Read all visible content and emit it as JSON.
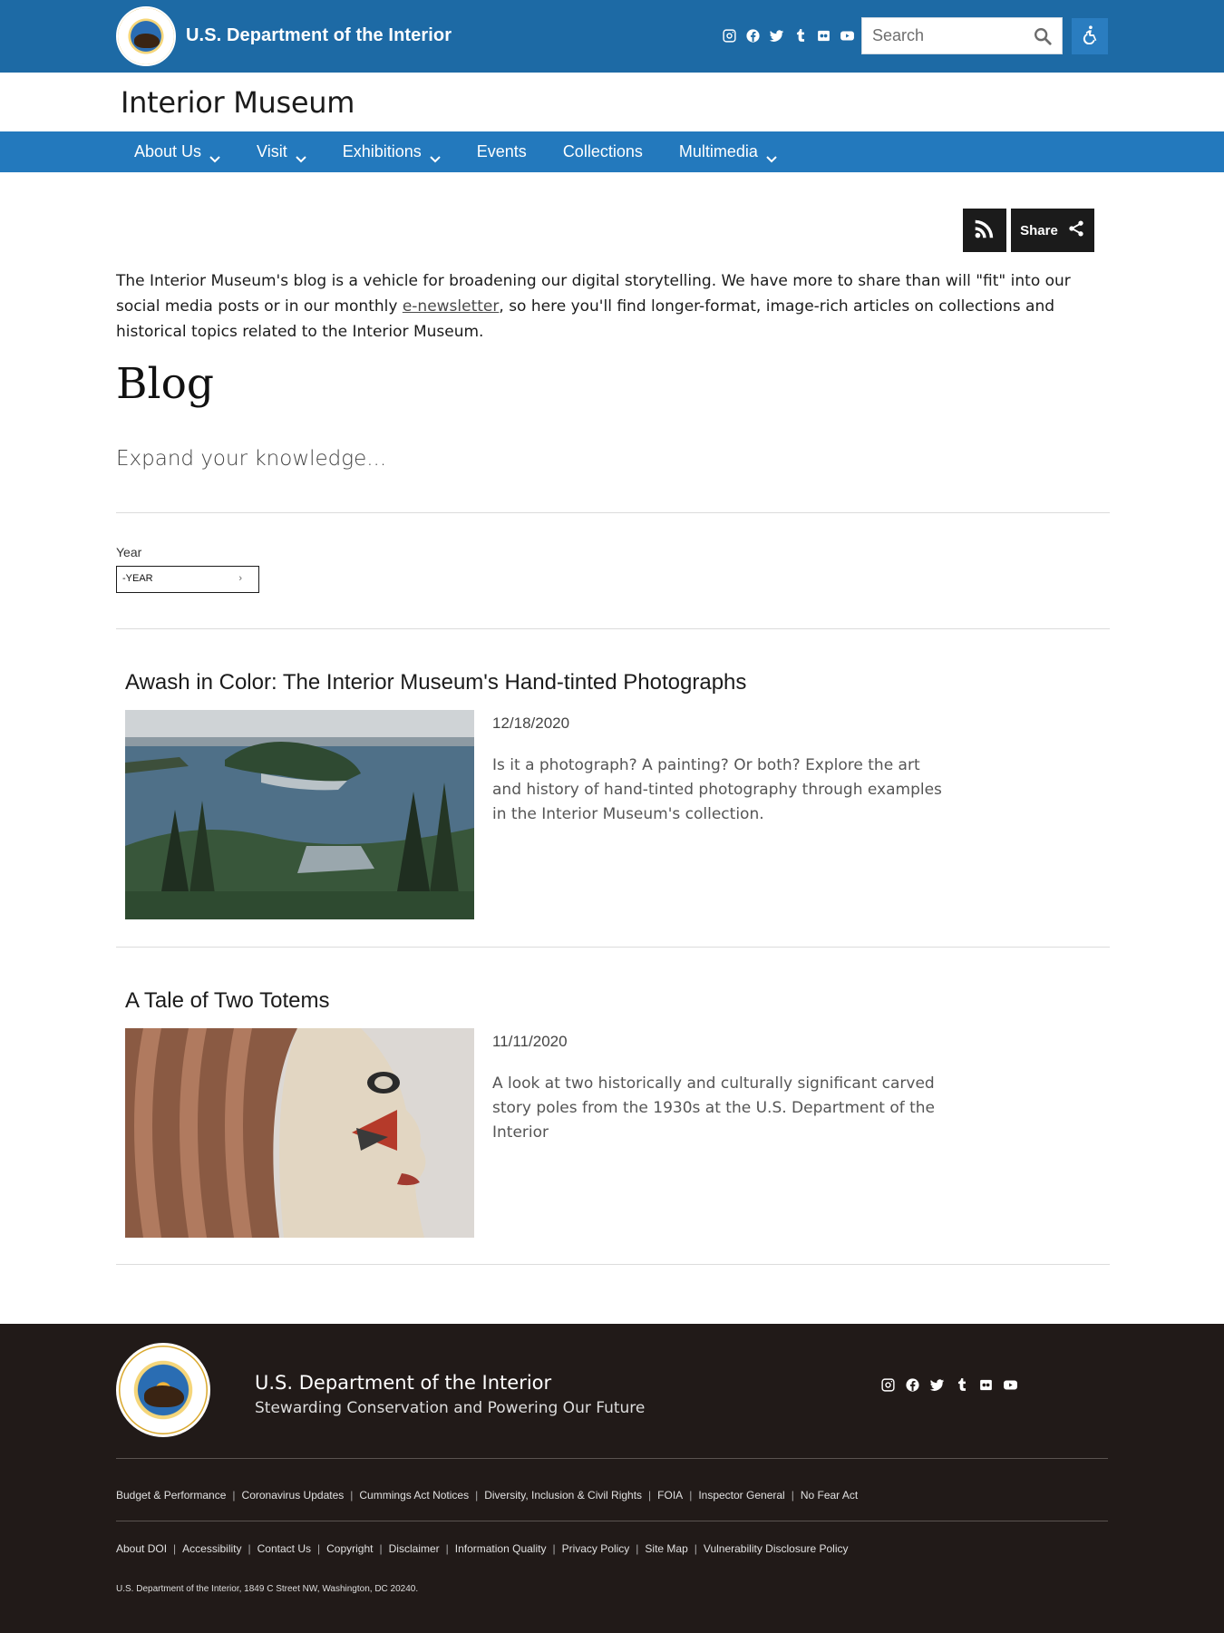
{
  "header": {
    "dept_title": "U.S. Department of the Interior",
    "search_placeholder": "Search",
    "social_icons": [
      "instagram-icon",
      "facebook-icon",
      "twitter-icon",
      "tumblr-icon",
      "flickr-icon",
      "youtube-icon"
    ],
    "accessibility_icon": "accessibility-icon"
  },
  "site": {
    "title": "Interior Museum"
  },
  "nav": {
    "items": [
      {
        "label": "About Us",
        "dropdown": true
      },
      {
        "label": "Visit",
        "dropdown": true
      },
      {
        "label": "Exhibitions",
        "dropdown": true
      },
      {
        "label": "Events",
        "dropdown": false
      },
      {
        "label": "Collections",
        "dropdown": false
      },
      {
        "label": "Multimedia",
        "dropdown": true
      }
    ]
  },
  "share": {
    "label": "Share",
    "rss_icon": "rss-icon"
  },
  "intro": {
    "text_before": "The Interior Museum's blog is a vehicle for broadening our digital storytelling. We have more to share than will \"fit\" into our social media posts or in our monthly ",
    "link_text": "e-newsletter",
    "text_after": ", so here you'll find longer-format, image-rich articles on collections and historical topics related to the Interior Museum."
  },
  "blog": {
    "heading": "Blog",
    "tagline": "Expand your knowledge..."
  },
  "filter": {
    "year_label": "Year",
    "year_value": "-YEAR"
  },
  "articles": [
    {
      "title": "Awash in Color: The Interior Museum's Hand-tinted Photographs",
      "date": "12/18/2020",
      "description": "Is it a photograph? A painting? Or both? Explore the art and history of hand-tinted photography through examples in the Interior Museum's collection."
    },
    {
      "title": "A Tale of Two Totems",
      "date": "11/11/2020",
      "description": "A look at two historically and culturally significant carved story poles from the 1930s at the U.S. Department of the Interior"
    }
  ],
  "footer": {
    "dept": "U.S. Department of the Interior",
    "tagline": "Stewarding Conservation and Powering Our Future",
    "links_row1": [
      "Budget & Performance",
      "Coronavirus Updates",
      "Cummings Act Notices",
      "Diversity, Inclusion & Civil Rights",
      "FOIA",
      "Inspector General",
      "No Fear Act"
    ],
    "links_row2": [
      "About DOI",
      "Accessibility",
      "Contact Us",
      "Copyright",
      "Disclaimer",
      "Information Quality",
      "Privacy Policy",
      "Site Map",
      "Vulnerability Disclosure Policy"
    ],
    "address": "U.S. Department of the Interior, 1849 C Street NW, Washington, DC 20240."
  },
  "colors": {
    "topbar": "#1d6aa5",
    "navbar": "#2379bd",
    "footer": "#211a18",
    "button_dark": "#1b1b1b"
  }
}
